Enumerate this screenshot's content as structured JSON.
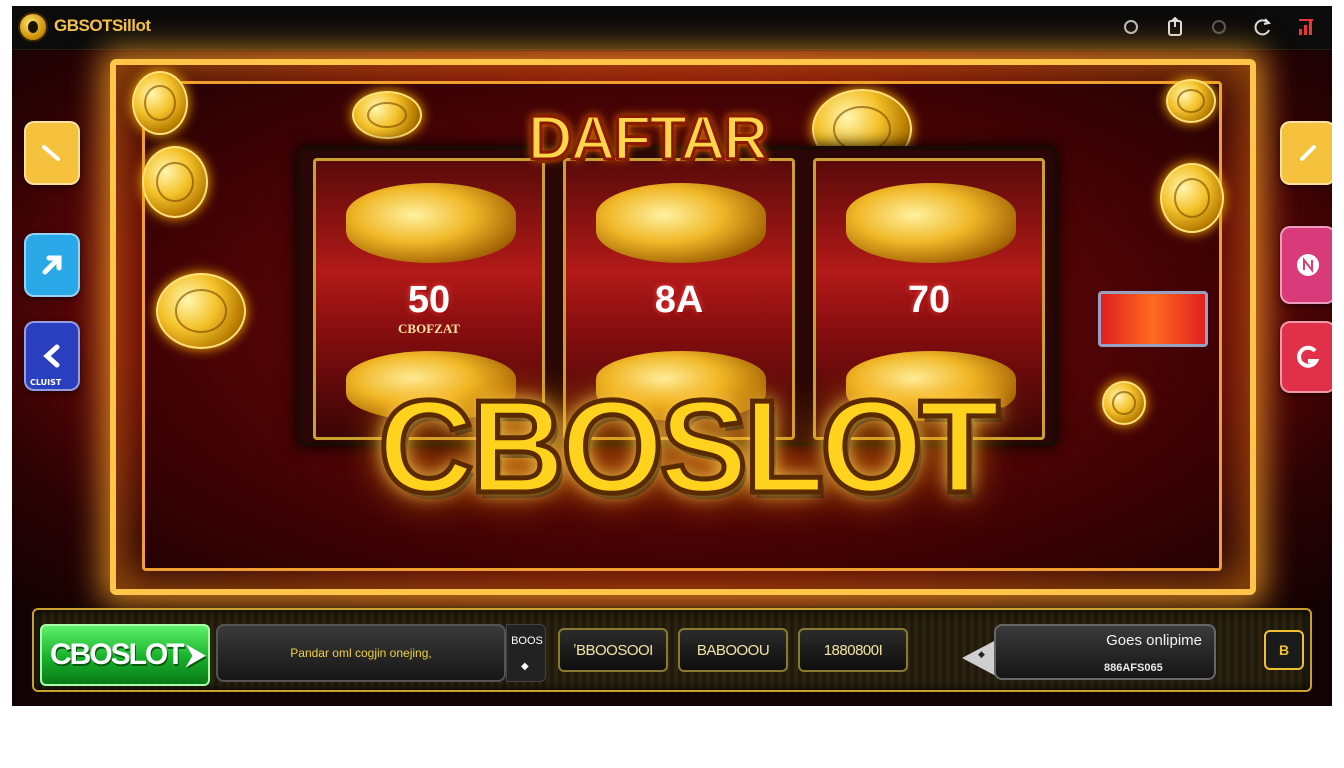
{
  "app": {
    "title": "GBSOTSillot"
  },
  "topbar": {
    "icons": [
      "record-icon",
      "share-icon",
      "circle-icon",
      "refresh-icon",
      "signal-icon"
    ]
  },
  "banner": {
    "headline": "DAFTAR",
    "brand": "CBOSLOT"
  },
  "reels": [
    {
      "value": "50",
      "label": "CBOFZAT"
    },
    {
      "value": "8A",
      "label": ""
    },
    {
      "value": "70",
      "label": ""
    }
  ],
  "side_buttons": {
    "left": [
      {
        "icon": "pencil-icon",
        "color": "#f6c13c"
      },
      {
        "icon": "arrow-up-right-icon",
        "color": "#2aa8e8"
      },
      {
        "icon": "chevron-left-icon",
        "color": "#2a3fc0",
        "label": "CLUIST"
      }
    ],
    "right": [
      {
        "icon": "pencil-icon",
        "color": "#f6c13c"
      },
      {
        "icon": "circle-n-icon",
        "color": "#d83a7a"
      },
      {
        "icon": "g-icon",
        "color": "#e0304a"
      }
    ]
  },
  "bottom": {
    "register_label": "CBOSLOT",
    "register_arrow": "⮞",
    "search_placeholder": "Pandar oml cogjin onejing,",
    "search_side_label": "BOOS",
    "search_side_dot": "◆",
    "stats": [
      "ʼBBOOSOOI",
      "BABOOOU",
      "1880800I"
    ],
    "status_label": "Goes onlipime",
    "status_value": "886AFS065",
    "menu_label": "B"
  }
}
